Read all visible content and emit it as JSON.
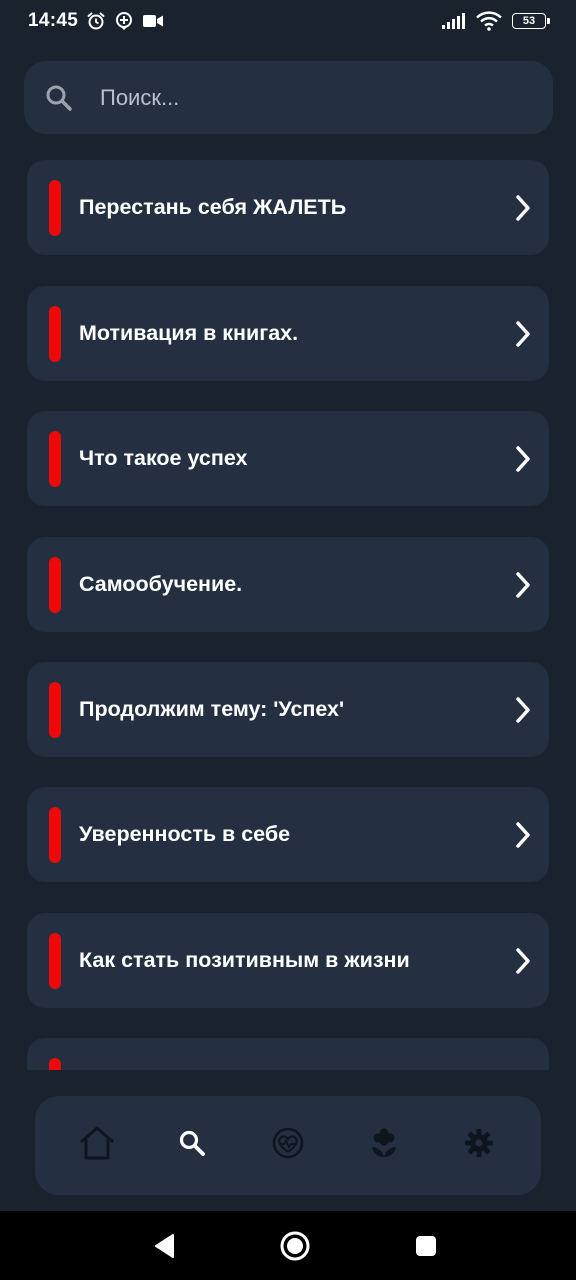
{
  "status_bar": {
    "time": "14:45",
    "battery": "53",
    "icons": [
      "alarm-icon",
      "smart-alert-icon",
      "video-camera-icon",
      "signal-icon",
      "wifi-icon",
      "battery-icon"
    ]
  },
  "search": {
    "placeholder": "Поиск...",
    "value": "",
    "icon": "search-icon"
  },
  "articles": [
    {
      "title": "Перестань себя ЖАЛЕТЬ"
    },
    {
      "title": "Мотивация в книгах."
    },
    {
      "title": "Что такое успех"
    },
    {
      "title": "Самообучение."
    },
    {
      "title": "Продолжим тему: 'Успех'"
    },
    {
      "title": "Уверенность в себе"
    },
    {
      "title": "Как стать позитивным в жизни"
    },
    {
      "title": ""
    }
  ],
  "bottom_nav": {
    "items": [
      {
        "icon": "home-icon",
        "active": false
      },
      {
        "icon": "search-icon",
        "active": true
      },
      {
        "icon": "heart-pulse-icon",
        "active": false
      },
      {
        "icon": "flower-icon",
        "active": false
      },
      {
        "icon": "gear-icon",
        "active": false
      }
    ]
  },
  "colors": {
    "background": "#1a222d",
    "card": "#243041",
    "accent_marker": "#ee0808",
    "inactive_icon": "#0f151d",
    "active_icon": "#ffffff"
  }
}
